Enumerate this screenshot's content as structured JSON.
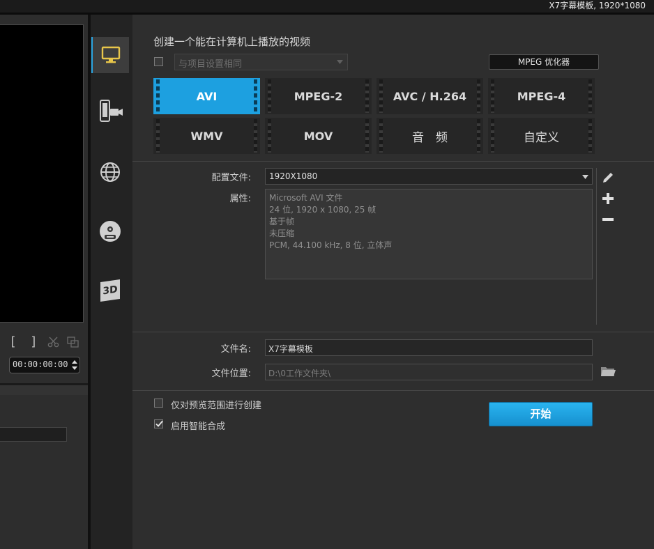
{
  "window": {
    "title": "X7字幕模板, 1920*1080"
  },
  "preview": {
    "mark_in": "[",
    "mark_out": "]",
    "timecode": "00:00:00:00"
  },
  "sidebar": {
    "items": [
      {
        "name": "computer",
        "icon": "monitor-icon",
        "active": true
      },
      {
        "name": "device",
        "icon": "mobile-camera-icon",
        "active": false
      },
      {
        "name": "web",
        "icon": "globe-icon",
        "active": false
      },
      {
        "name": "disc",
        "icon": "dvd-disc-icon",
        "active": false
      },
      {
        "name": "3d",
        "icon": "3d-icon",
        "label": "3D",
        "active": false
      }
    ]
  },
  "main": {
    "heading": "创建一个能在计算机上播放的视频",
    "same_as_project": {
      "label": "与项目设置相同",
      "checked": false
    },
    "mpeg_optimizer_label": "MPEG 优化器",
    "formats": [
      {
        "label": "AVI",
        "selected": true
      },
      {
        "label": "MPEG-2",
        "selected": false
      },
      {
        "label": "AVC / H.264",
        "selected": false
      },
      {
        "label": "MPEG-4",
        "selected": false
      },
      {
        "label": "WMV",
        "selected": false
      },
      {
        "label": "MOV",
        "selected": false
      },
      {
        "label": "音　频",
        "selected": false
      },
      {
        "label": "自定义",
        "selected": false
      }
    ],
    "profile_label": "配置文件:",
    "profile_value": "1920X1080",
    "properties_label": "属性:",
    "properties": [
      "Microsoft AVI 文件",
      "24 位, 1920 x 1080, 25 帧",
      "基于帧",
      "未压缩",
      "PCM, 44.100 kHz, 8 位, 立体声"
    ],
    "filename_label": "文件名:",
    "filename_value": "X7字幕模板",
    "location_label": "文件位置:",
    "location_value": "D:\\0工作文件夹\\",
    "preview_range_label": "仅对预览范围进行创建",
    "preview_range_checked": false,
    "smart_render_label": "启用智能合成",
    "smart_render_checked": true,
    "start_label": "开始"
  },
  "colors": {
    "accent": "#1da0e0",
    "background": "#2e2e2e"
  }
}
